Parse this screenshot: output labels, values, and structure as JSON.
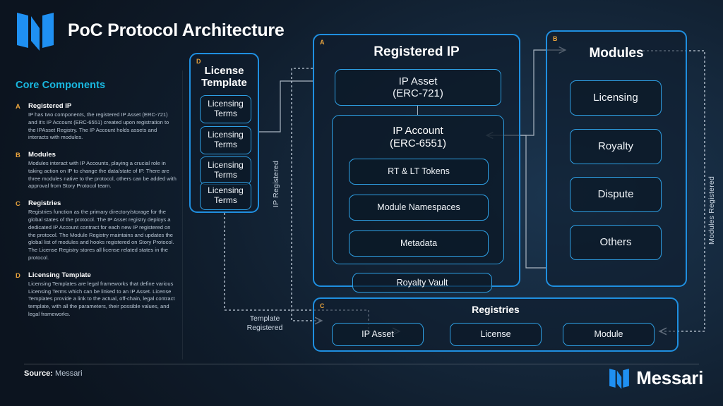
{
  "header": {
    "title": "PoC Protocol Architecture",
    "logo_icon": "messari-m-logo-icon"
  },
  "left_panel": {
    "section_title": "Core Components",
    "items": [
      {
        "letter": "A",
        "title": "Registered IP",
        "description": "IP has two components, the registered IP Asset (ERC-721) and it's IP Account (ERC-6551) created upon registration to the IPAsset Registry. The IP Account holds assets and interacts with modules."
      },
      {
        "letter": "B",
        "title": "Modules",
        "description": "Modules interact with IP Accounts, playing a crucial role in taking action on IP to change the data/state of IP.  There are three modules native to the protocol, others can be added with approval from Story Protocol team."
      },
      {
        "letter": "C",
        "title": "Registries",
        "description": "Registries function as the primary directory/storage for the global states of the protocol. The IP Asset registry deploys a dedicated IP Account contract for each new IP registered on the protocol. The Module Registry maintains and updates the global list of modules and hooks registered on Story Protocol. The License Registry stores all license related states in the protocol."
      },
      {
        "letter": "D",
        "title": "Licensing Template",
        "description": "Licensing Templates are legal frameworks that define various Licensing Terms which can be linked to an IP Asset. License Templates provide a link to the actual, off-chain, legal contract template, with all the parameters, their possible values, and legal frameworks."
      }
    ]
  },
  "diagram": {
    "license_template": {
      "letter": "D",
      "title": "License Template",
      "terms": [
        "Licensing Terms",
        "Licensing Terms",
        "Licensing Terms",
        "Licensing Terms"
      ]
    },
    "registered_ip": {
      "letter": "A",
      "title": "Registered IP",
      "ip_asset": "IP Asset (ERC-721)",
      "ip_asset_line1": "IP Asset",
      "ip_asset_line2": "(ERC-721)",
      "ip_account_line1": "IP Account",
      "ip_account_line2": "(ERC-6551)",
      "ip_account_children": [
        "RT & LT Tokens",
        "Module Namespaces",
        "Metadata"
      ],
      "royalty_vault": "Royalty Vault"
    },
    "modules": {
      "letter": "B",
      "title": "Modules",
      "items": [
        "Licensing",
        "Royalty",
        "Dispute",
        "Others"
      ]
    },
    "registries": {
      "letter": "C",
      "title": "Registries",
      "items": [
        "IP Asset",
        "License",
        "Module"
      ]
    },
    "connector_labels": {
      "ip_registered": "IP Registered",
      "modules_registered": "Modules Registered",
      "template_registered_line1": "Template",
      "template_registered_line2": "Registered"
    }
  },
  "footer": {
    "source_label": "Source:",
    "source_value": "Messari",
    "brand": "Messari",
    "brand_logo_icon": "messari-m-logo-icon"
  },
  "colors": {
    "accent_blue": "#1f8fe0",
    "node_border": "#2e9fe3",
    "letter_orange": "#e8a33d",
    "section_cyan": "#19b8e0",
    "background_dark": "#0d1520",
    "connector_gray": "#aab6c2"
  }
}
